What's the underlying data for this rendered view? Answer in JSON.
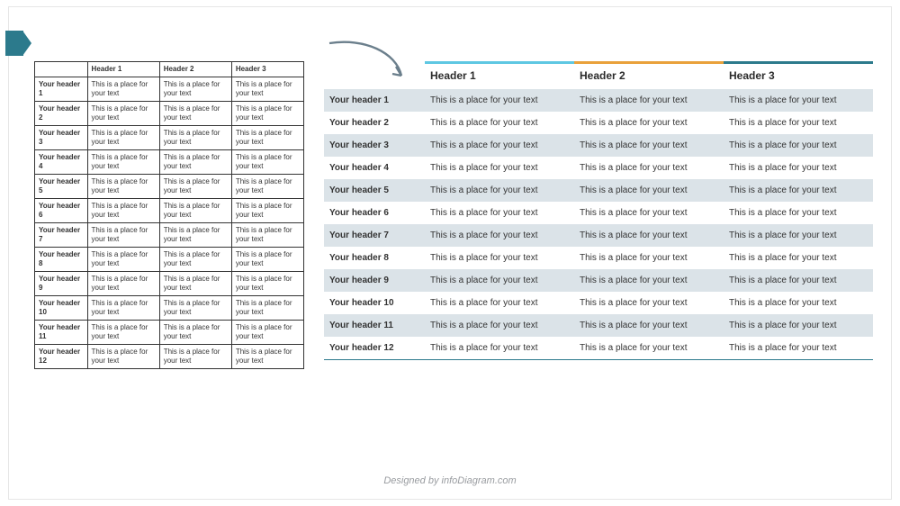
{
  "plain": {
    "headers": [
      "",
      "Header 1",
      "Header 2",
      "Header 3"
    ],
    "rows": [
      {
        "label": "Your header 1",
        "c1": "This is a place for your text",
        "c2": "This is a place for your text",
        "c3": "This is a place for your text"
      },
      {
        "label": "Your header 2",
        "c1": "This is a place for your text",
        "c2": "This is a place for your text",
        "c3": "This is a place for your text"
      },
      {
        "label": "Your header 3",
        "c1": "This is a place for your text",
        "c2": "This is a place for your text",
        "c3": "This is a place for your text"
      },
      {
        "label": "Your header 4",
        "c1": "This is a place for your text",
        "c2": "This is a place for your text",
        "c3": "This is a place for your text"
      },
      {
        "label": "Your header 5",
        "c1": "This is a place for your text",
        "c2": "This is a place for your text",
        "c3": "This is a place for your text"
      },
      {
        "label": "Your header 6",
        "c1": "This is a place for your text",
        "c2": "This is a place for your text",
        "c3": "This is a place for your text"
      },
      {
        "label": "Your header 7",
        "c1": "This is a place for your text",
        "c2": "This is a place for your text",
        "c3": "This is a place for your text"
      },
      {
        "label": "Your header 8",
        "c1": "This is a place for your text",
        "c2": "This is a place for your text",
        "c3": "This is a place for your text"
      },
      {
        "label": "Your header 9",
        "c1": "This is a place for your text",
        "c2": "This is a place for your text",
        "c3": "This is a place for your text"
      },
      {
        "label": "Your header 10",
        "c1": "This is a place for your text",
        "c2": "This is a place for your text",
        "c3": "This is a place for your text"
      },
      {
        "label": "Your header 11",
        "c1": "This is a place for your text",
        "c2": "This is a place for your text",
        "c3": "This is a place for your text"
      },
      {
        "label": "Your header 12",
        "c1": "This is a place for your text",
        "c2": "This is a place for your text",
        "c3": "This is a place for your text"
      }
    ]
  },
  "modern": {
    "headers": [
      "",
      "Header 1",
      "Header 2",
      "Header 3"
    ],
    "rows": [
      {
        "label": "Your header 1",
        "c1": "This is a place for your text",
        "c2": "This is a place for your text",
        "c3": "This is a place for your text"
      },
      {
        "label": "Your header 2",
        "c1": "This is a place for your text",
        "c2": "This is a place for your text",
        "c3": "This is a place for your text"
      },
      {
        "label": "Your header 3",
        "c1": "This is a place for your text",
        "c2": "This is a place for your text",
        "c3": "This is a place for your text"
      },
      {
        "label": "Your header 4",
        "c1": "This is a place for your text",
        "c2": "This is a place for your text",
        "c3": "This is a place for your text"
      },
      {
        "label": "Your header 5",
        "c1": "This is a place for your text",
        "c2": "This is a place for your text",
        "c3": "This is a place for your text"
      },
      {
        "label": "Your header 6",
        "c1": "This is a place for your text",
        "c2": "This is a place for your text",
        "c3": "This is a place for your text"
      },
      {
        "label": "Your header 7",
        "c1": "This is a place for your text",
        "c2": "This is a place for your text",
        "c3": "This is a place for your text"
      },
      {
        "label": "Your header 8",
        "c1": "This is a place for your text",
        "c2": "This is a place for your text",
        "c3": "This is a place for your text"
      },
      {
        "label": "Your header 9",
        "c1": "This is a place for your text",
        "c2": "This is a place for your text",
        "c3": "This is a place for your text"
      },
      {
        "label": "Your header 10",
        "c1": "This is a place for your text",
        "c2": "This is a place for your text",
        "c3": "This is a place for your text"
      },
      {
        "label": "Your header 11",
        "c1": "This is a place for your text",
        "c2": "This is a place for your text",
        "c3": "This is a place for your text"
      },
      {
        "label": "Your header 12",
        "c1": "This is a place for your text",
        "c2": "This is a place for your text",
        "c3": "This is a place for your text"
      }
    ]
  },
  "footer": "Designed by infoDiagram.com"
}
